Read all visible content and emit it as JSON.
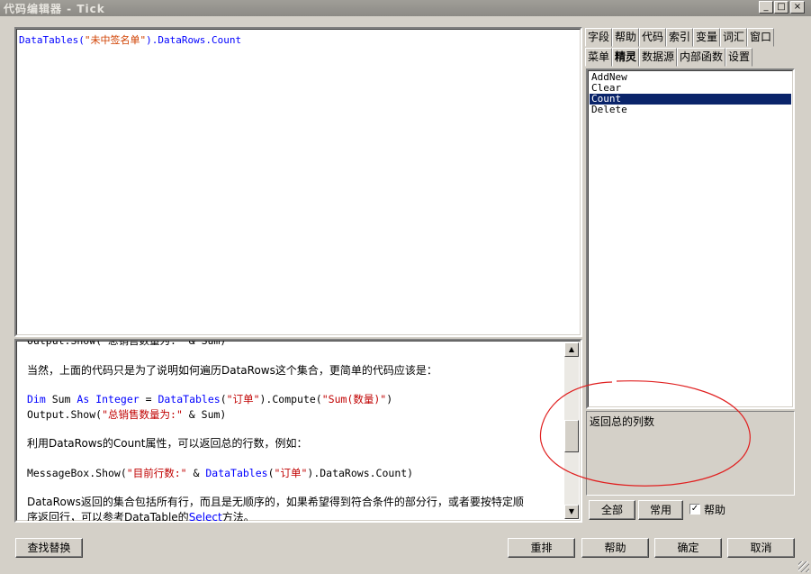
{
  "window": {
    "title": "代码编辑器 - Tick",
    "min": "_",
    "max": "□",
    "close": "×"
  },
  "editor": {
    "pre": "DataTables(",
    "str": "\"未中签名单\"",
    "post": ").DataRows.Count"
  },
  "help": {
    "cut_line": "Output.Show(\"总销售数量为:\" & Sum)",
    "para1": "当然，上面的代码只是为了说明如何遍历DataRows这个集合，更简单的代码应该是：",
    "code1_kw1": "Dim",
    "code1_t1": " Sum ",
    "code1_kw2": "As",
    "code1_t2": " ",
    "code1_kw3": "Integer",
    "code1_t3": " = ",
    "code1_kw4": "DataTables",
    "code1_t4": "(",
    "code1_s1": "\"订单\"",
    "code1_t5": ").Compute(",
    "code1_s2": "\"Sum(数量)\"",
    "code1_t6": ")",
    "code2_t1": "Output.Show(",
    "code2_s1": "\"总销售数量为:\"",
    "code2_t2": " & Sum)",
    "para2": "利用DataRows的Count属性，可以返回总的行数，例如：",
    "code3_t1": "MessageBox.Show(",
    "code3_s1": "\"目前行数:\"",
    "code3_t2": " & ",
    "code3_kw1": "DataTables",
    "code3_t3": "(",
    "code3_s2": "\"订单\"",
    "code3_t4": ").DataRows.Count)",
    "para3": "DataRows返回的集合包括所有行，而且是无顺序的，如果希望得到符合条件的部分行，或者要按特定顺",
    "para4_a": "序返回行，可以参考DataTable的",
    "para4_link": "Select",
    "para4_b": "方法。"
  },
  "tabs_row1": [
    "字段",
    "帮助",
    "代码",
    "索引",
    "变量",
    "词汇",
    "窗口"
  ],
  "tabs_row2": [
    "菜单",
    "精灵",
    "数据源",
    "内部函数",
    "设置"
  ],
  "members": [
    "AddNew",
    "Clear",
    "Count",
    "Delete"
  ],
  "selected_member": "Count",
  "member_desc": "返回总的列数",
  "right_buttons": {
    "all": "全部",
    "common": "常用",
    "help_check": "帮助",
    "help_checked": true
  },
  "bottom": {
    "find_replace": "查找替换",
    "rearrange": "重排",
    "help": "帮助",
    "ok": "确定",
    "cancel": "取消"
  },
  "colors": {
    "annotation": "#e02020",
    "selection": "#0a246a"
  }
}
